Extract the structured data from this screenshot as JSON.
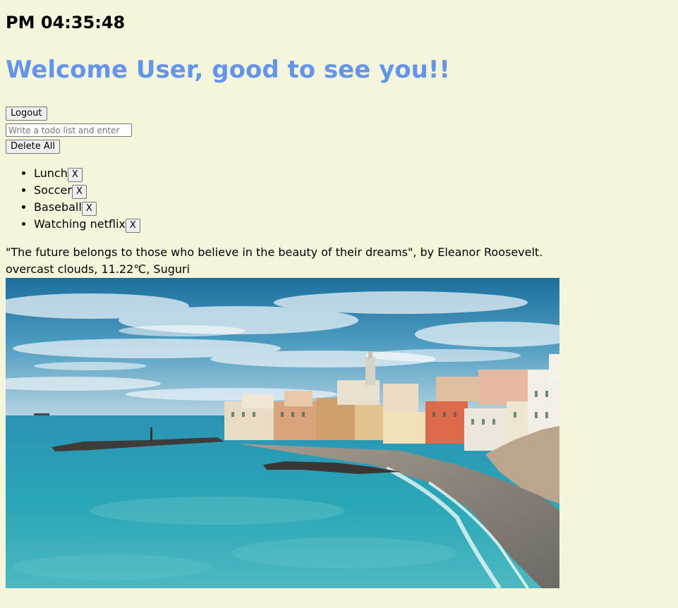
{
  "clock": {
    "time": "PM 04:35:48"
  },
  "greeting": "Welcome User, good to see you!!",
  "logout_label": "Logout",
  "todo_input": {
    "placeholder": "Write a todo list and enter",
    "value": ""
  },
  "delete_all_label": "Delete All",
  "todos": [
    {
      "text": "Lunch",
      "remove_label": "X"
    },
    {
      "text": "Soccer",
      "remove_label": "X"
    },
    {
      "text": "Baseball",
      "remove_label": "X"
    },
    {
      "text": "Watching netflix",
      "remove_label": "X"
    }
  ],
  "quote": "\"The future belongs to those who believe in the beauty of their dreams\", by Eleanor Roosevelt.",
  "weather": "overcast clouds, 11.22℃, Suguri",
  "colors": {
    "background": "#f5f5dc",
    "greeting": "#6495ed"
  }
}
